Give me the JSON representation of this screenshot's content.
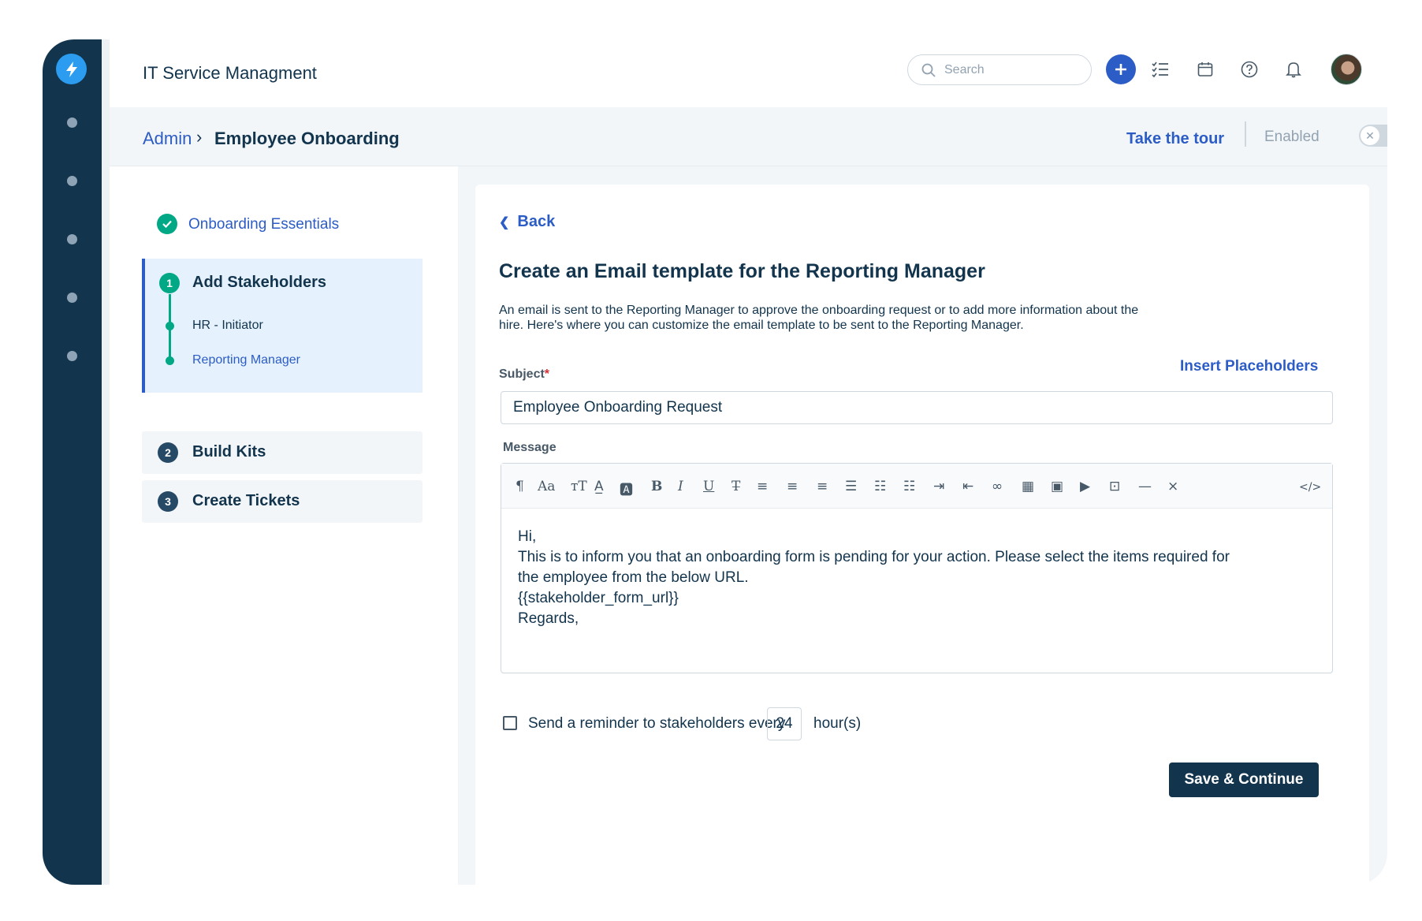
{
  "app": {
    "title": "IT Service Managment"
  },
  "search": {
    "placeholder": "Search"
  },
  "breadcrumb": {
    "admin": "Admin",
    "separator": "›",
    "current": "Employee Onboarding"
  },
  "header_actions": {
    "tour": "Take the tour",
    "enabled_label": "Enabled",
    "toggle_symbol": "✕",
    "enabled": false
  },
  "steps": {
    "done": {
      "label": "Onboarding Essentials"
    },
    "active": {
      "number": "1",
      "label": "Add Stakeholders",
      "substeps": [
        "HR - Initiator",
        "Reporting Manager"
      ]
    },
    "others": [
      {
        "number": "2",
        "label": "Build Kits"
      },
      {
        "number": "3",
        "label": "Create Tickets"
      }
    ]
  },
  "form": {
    "back_label": "Back",
    "title": "Create an Email template for the Reporting Manager",
    "description": "An email is sent to the Reporting Manager to approve the onboarding request or to add more information about the hire. Here's where you can customize the email template to be sent to the Reporting Manager.",
    "subject_label": "Subject",
    "required_mark": "*",
    "insert_placeholders": "Insert Placeholders",
    "subject_value": "Employee Onboarding Request",
    "message_label": "Message",
    "toolbar": [
      {
        "name": "paragraph-icon",
        "glyph": "¶"
      },
      {
        "name": "font-size-icon",
        "glyph": "Aa"
      },
      {
        "name": "text-size-icon",
        "glyph": "ᴛT"
      },
      {
        "name": "font-color-icon",
        "glyph": "A̲"
      },
      {
        "name": "background-color-icon",
        "glyph": "🅰"
      },
      {
        "name": "bold-icon",
        "glyph": "B"
      },
      {
        "name": "italic-icon",
        "glyph": "I"
      },
      {
        "name": "underline-icon",
        "glyph": "U"
      },
      {
        "name": "strikethrough-icon",
        "glyph": "T̶"
      },
      {
        "name": "align-left-icon",
        "glyph": "≡"
      },
      {
        "name": "align-center-icon",
        "glyph": "≡"
      },
      {
        "name": "align-right-icon",
        "glyph": "≡"
      },
      {
        "name": "align-justify-icon",
        "glyph": "☰"
      },
      {
        "name": "bulleted-list-icon",
        "glyph": "☷"
      },
      {
        "name": "numbered-list-icon",
        "glyph": "☷"
      },
      {
        "name": "indent-icon",
        "glyph": "⇥"
      },
      {
        "name": "outdent-icon",
        "glyph": "⇤"
      },
      {
        "name": "link-icon",
        "glyph": "∞"
      },
      {
        "name": "table-icon",
        "glyph": "▦"
      },
      {
        "name": "image-icon",
        "glyph": "▣"
      },
      {
        "name": "video-icon",
        "glyph": "▶"
      },
      {
        "name": "embed-icon",
        "glyph": "⊡"
      },
      {
        "name": "horizontal-rule-icon",
        "glyph": "—"
      },
      {
        "name": "clear-format-icon",
        "glyph": "⨯"
      }
    ],
    "code_view": "</>",
    "message_lines": [
      "Hi,",
      "This is to inform you that an onboarding form is pending for your action. Please select the items required for",
      "the employee from the below URL.",
      "{{stakeholder_form_url}}",
      "Regards,"
    ],
    "reminder_text": "Send a reminder to stakeholders every",
    "reminder_value": "24",
    "reminder_unit": "hour(s)",
    "save_button": "Save & Continue"
  },
  "colors": {
    "rail": "#12344d",
    "accent": "#2c5cc5",
    "success": "#00a886",
    "primary_button": "#12344d"
  }
}
